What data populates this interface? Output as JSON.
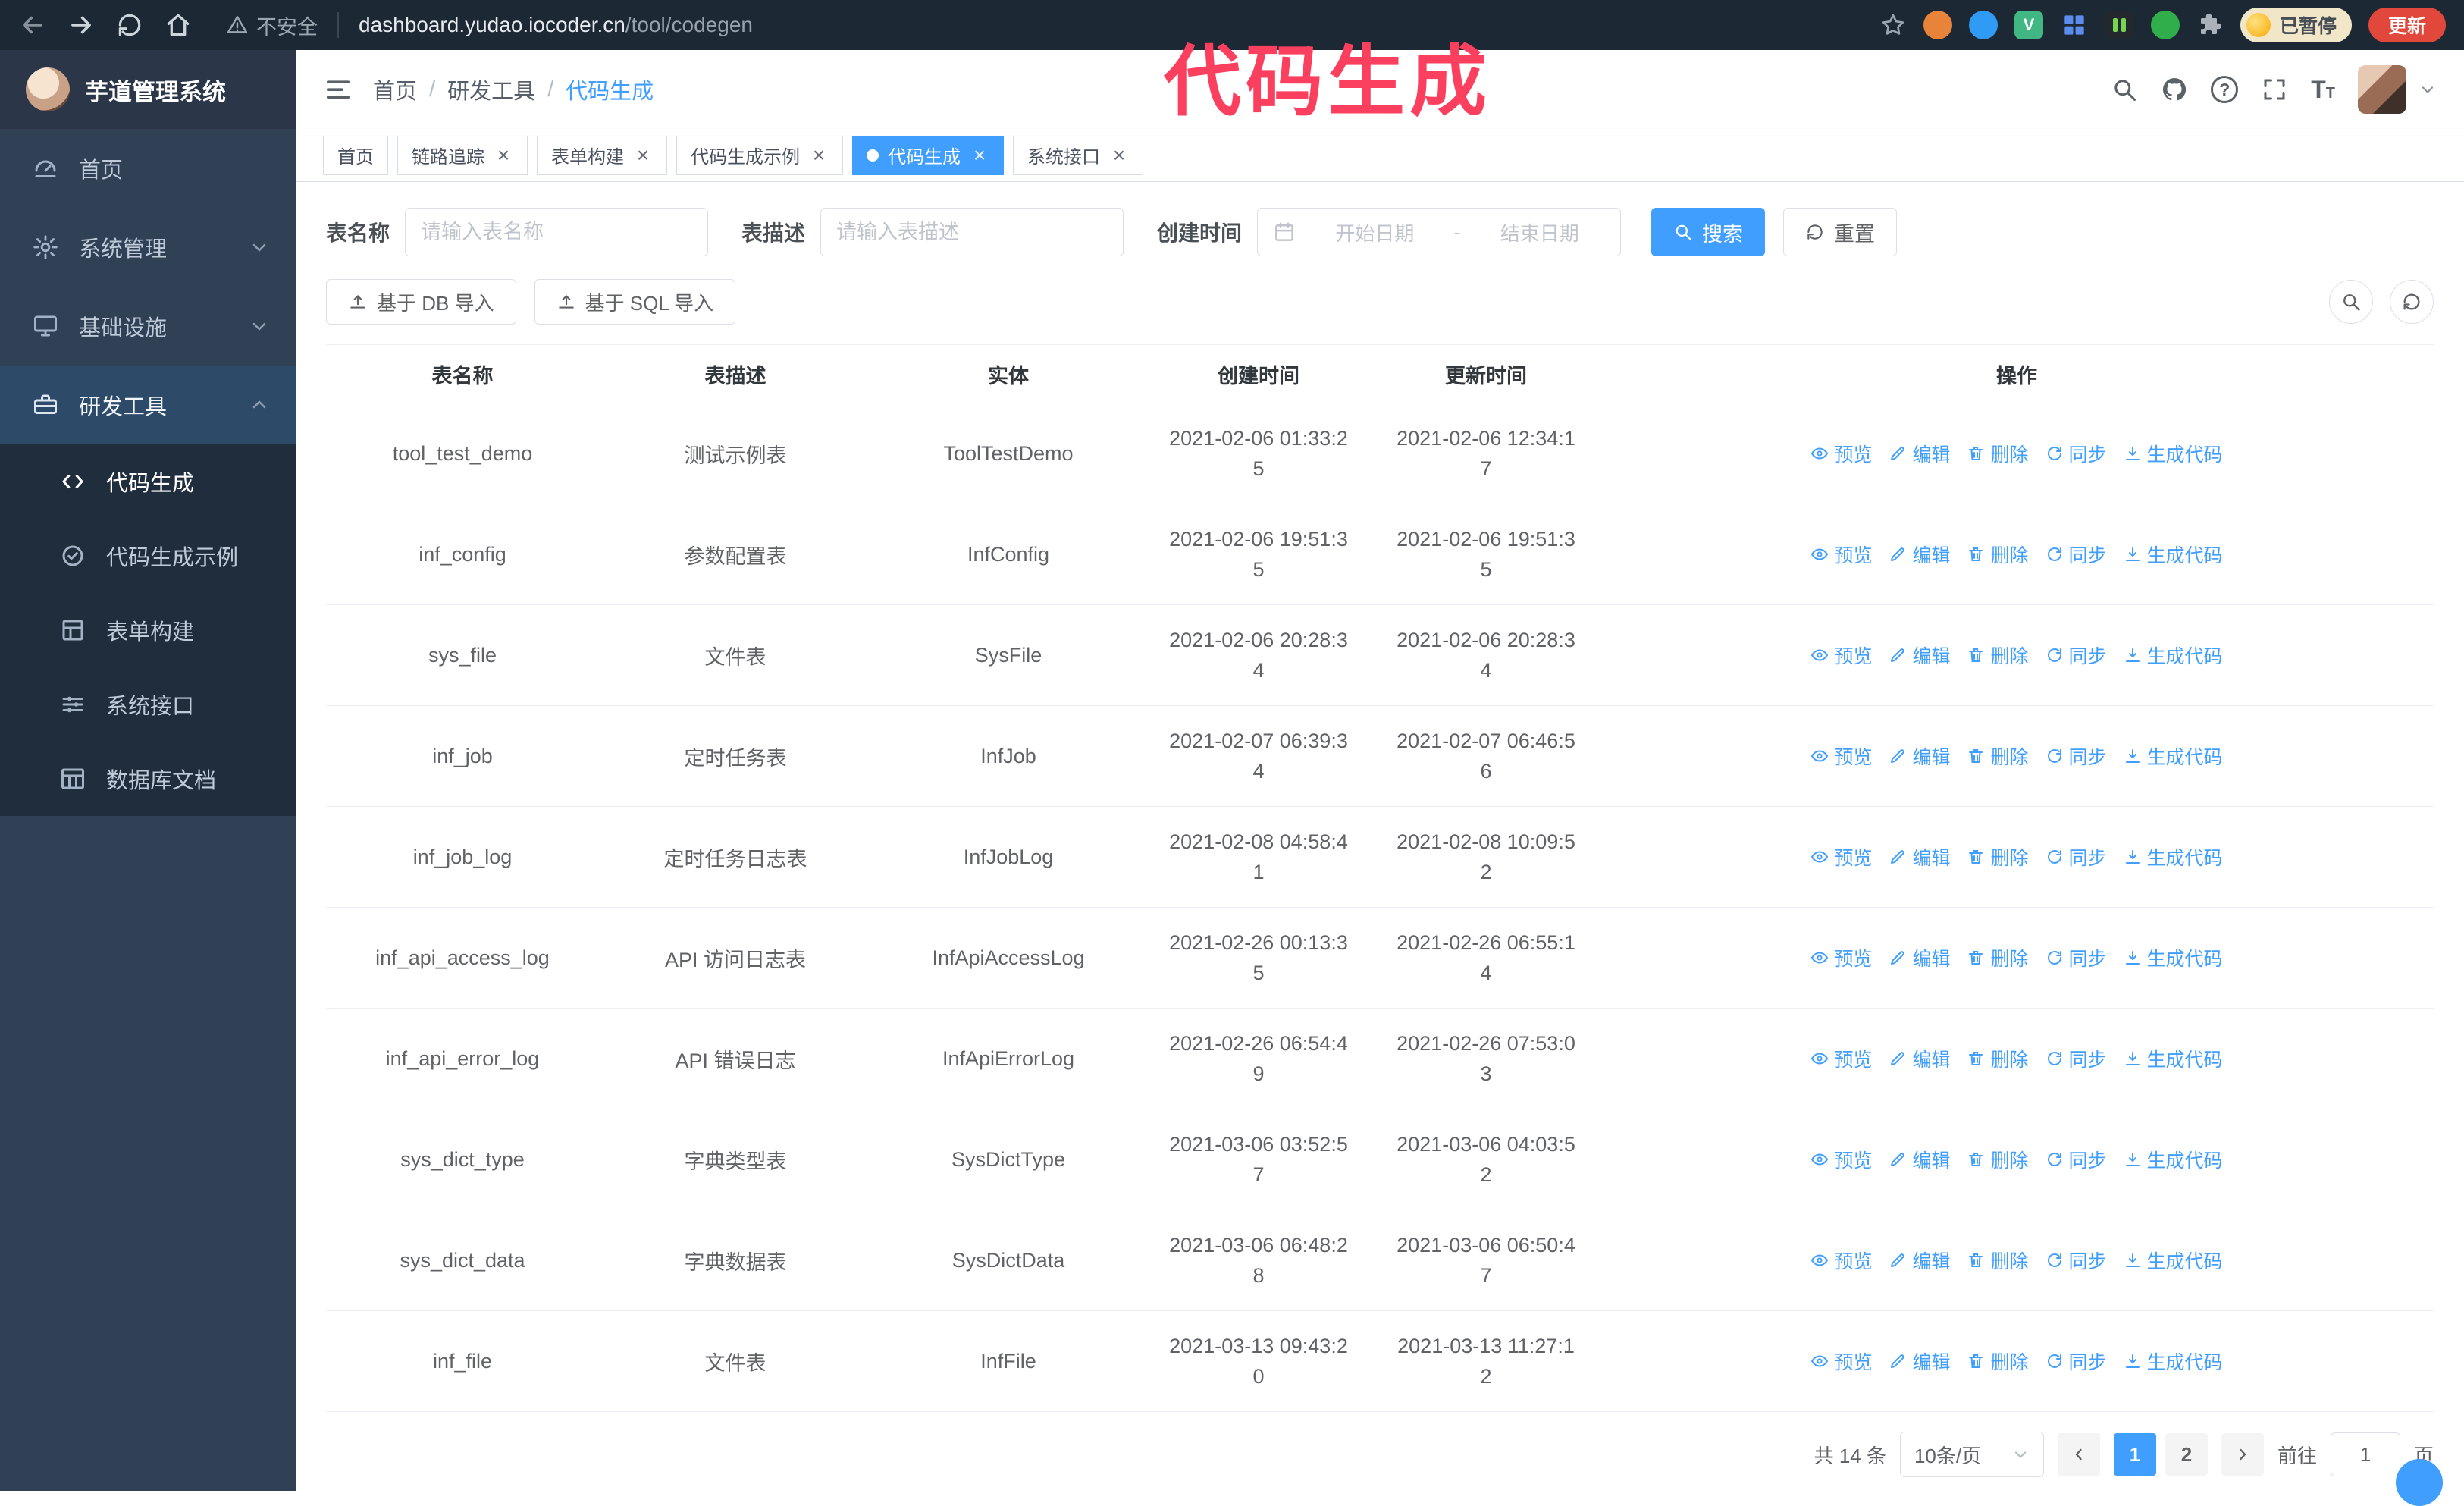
{
  "browser": {
    "security_label": "不安全",
    "url_domain": "dashboard.yudao.iocoder.cn",
    "url_path": "/tool/codegen",
    "paused_badge": "已暂停",
    "update_button": "更新"
  },
  "annotation": {
    "text": "代码生成",
    "color": "#fb3f5f"
  },
  "sidebar": {
    "logo_title": "芋道管理系统",
    "menu": [
      {
        "key": "home",
        "label": "首页",
        "icon": "dashboard"
      },
      {
        "key": "system",
        "label": "系统管理",
        "icon": "gear",
        "chevron": "down"
      },
      {
        "key": "infra",
        "label": "基础设施",
        "icon": "monitor",
        "chevron": "down"
      },
      {
        "key": "devtools",
        "label": "研发工具",
        "icon": "toolbox",
        "chevron": "up",
        "expanded": true,
        "children": [
          {
            "key": "codegen",
            "label": "代码生成",
            "icon": "code",
            "active": true
          },
          {
            "key": "codegen-example",
            "label": "代码生成示例",
            "icon": "badge"
          },
          {
            "key": "form-build",
            "label": "表单构建",
            "icon": "form"
          },
          {
            "key": "api",
            "label": "系统接口",
            "icon": "api"
          },
          {
            "key": "db-doc",
            "label": "数据库文档",
            "icon": "db"
          }
        ]
      }
    ]
  },
  "header": {
    "breadcrumb": [
      "首页",
      "研发工具",
      "代码生成"
    ]
  },
  "tabs": [
    {
      "key": "home",
      "label": "首页",
      "closable": false
    },
    {
      "key": "tracer",
      "label": "链路追踪",
      "closable": true
    },
    {
      "key": "form-build",
      "label": "表单构建",
      "closable": true
    },
    {
      "key": "codegen-example",
      "label": "代码生成示例",
      "closable": true
    },
    {
      "key": "codegen",
      "label": "代码生成",
      "closable": true,
      "active": true
    },
    {
      "key": "api",
      "label": "系统接口",
      "closable": true
    }
  ],
  "filters": {
    "table_name_label": "表名称",
    "table_name_placeholder": "请输入表名称",
    "table_desc_label": "表描述",
    "table_desc_placeholder": "请输入表描述",
    "create_time_label": "创建时间",
    "date_start_placeholder": "开始日期",
    "date_separator": "-",
    "date_end_placeholder": "结束日期",
    "search_button": "搜索",
    "reset_button": "重置"
  },
  "toolbar": {
    "import_db_button": "基于 DB 导入",
    "import_sql_button": "基于 SQL 导入"
  },
  "table": {
    "columns": [
      "表名称",
      "表描述",
      "实体",
      "创建时间",
      "更新时间",
      "操作"
    ],
    "actions": [
      "预览",
      "编辑",
      "删除",
      "同步",
      "生成代码"
    ],
    "rows": [
      {
        "name": "tool_test_demo",
        "desc": "测试示例表",
        "entity": "ToolTestDemo",
        "created": "2021-02-06 01:33:25",
        "updated": "2021-02-06 12:34:17"
      },
      {
        "name": "inf_config",
        "desc": "参数配置表",
        "entity": "InfConfig",
        "created": "2021-02-06 19:51:35",
        "updated": "2021-02-06 19:51:35"
      },
      {
        "name": "sys_file",
        "desc": "文件表",
        "entity": "SysFile",
        "created": "2021-02-06 20:28:34",
        "updated": "2021-02-06 20:28:34"
      },
      {
        "name": "inf_job",
        "desc": "定时任务表",
        "entity": "InfJob",
        "created": "2021-02-07 06:39:34",
        "updated": "2021-02-07 06:46:56"
      },
      {
        "name": "inf_job_log",
        "desc": "定时任务日志表",
        "entity": "InfJobLog",
        "created": "2021-02-08 04:58:41",
        "updated": "2021-02-08 10:09:52"
      },
      {
        "name": "inf_api_access_log",
        "desc": "API 访问日志表",
        "entity": "InfApiAccessLog",
        "created": "2021-02-26 00:13:35",
        "updated": "2021-02-26 06:55:14"
      },
      {
        "name": "inf_api_error_log",
        "desc": "API 错误日志",
        "entity": "InfApiErrorLog",
        "created": "2021-02-26 06:54:49",
        "updated": "2021-02-26 07:53:03"
      },
      {
        "name": "sys_dict_type",
        "desc": "字典类型表",
        "entity": "SysDictType",
        "created": "2021-03-06 03:52:57",
        "updated": "2021-03-06 04:03:52"
      },
      {
        "name": "sys_dict_data",
        "desc": "字典数据表",
        "entity": "SysDictData",
        "created": "2021-03-06 06:48:28",
        "updated": "2021-03-06 06:50:47"
      },
      {
        "name": "inf_file",
        "desc": "文件表",
        "entity": "InfFile",
        "created": "2021-03-13 09:43:20",
        "updated": "2021-03-13 11:27:12"
      }
    ]
  },
  "pagination": {
    "total_text": "共 14 条",
    "page_size": "10条/页",
    "pages": [
      "1",
      "2"
    ],
    "current_page": "1",
    "goto_label": "前往",
    "goto_value": "1",
    "goto_suffix": "页"
  },
  "colors": {
    "accent": "#409eff",
    "sidebar_bg": "#304156",
    "submenu_bg": "#1f2d3d",
    "annotation": "#fb3f5f"
  }
}
